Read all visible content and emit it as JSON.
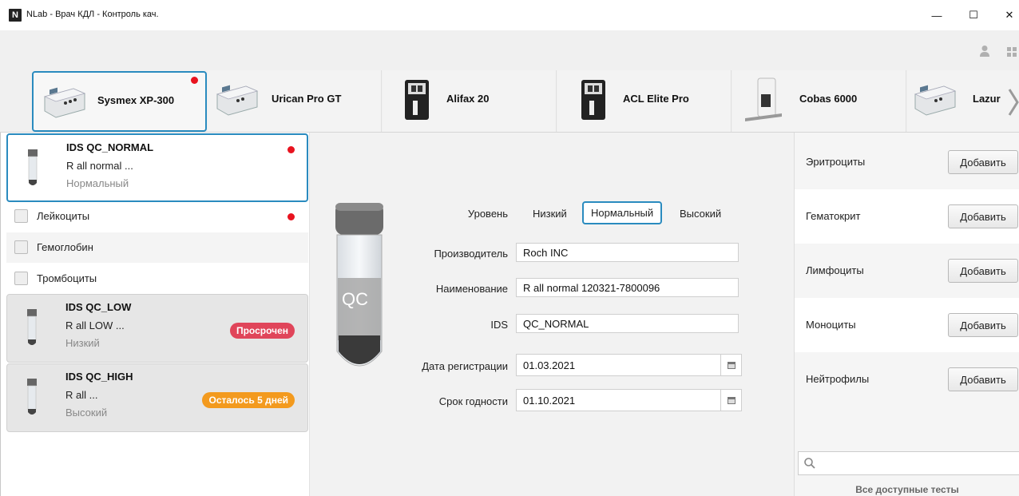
{
  "window": {
    "logo_letter": "N",
    "title": "NLab - Врач КДЛ - Контроль кач.",
    "minimize": "—",
    "maximize": "☐",
    "close": "✕"
  },
  "toolbar": {
    "icons": [
      "user-icon",
      "grid-icon"
    ]
  },
  "devices": [
    {
      "label": "Sysmex XP-300",
      "active": true,
      "alert": true
    },
    {
      "label": "Urican Pro GT",
      "active": false,
      "alert": false
    },
    {
      "label": "Alifax 20",
      "active": false,
      "alert": false
    },
    {
      "label": "ACL Elite Pro",
      "active": false,
      "alert": false
    },
    {
      "label": "Cobas 6000",
      "active": false,
      "alert": false
    },
    {
      "label": "Lazur",
      "active": false,
      "alert": false
    }
  ],
  "qc_list": {
    "selected": {
      "name": "IDS QC_NORMAL",
      "desc": "R all normal ...",
      "level": "Нормальный"
    },
    "params": [
      {
        "label": "Лейкоциты",
        "alert": true
      },
      {
        "label": "Гемоглобин",
        "alert": false
      },
      {
        "label": "Тромбоциты",
        "alert": false
      }
    ],
    "low": {
      "name": "IDS QC_LOW",
      "desc": "R all LOW ...",
      "level": "Низкий",
      "badge": "Просрочен",
      "badge_color": "#e0455a"
    },
    "high": {
      "name": "IDS QC_HIGH",
      "desc": "R all ...",
      "level": "Высокий",
      "badge": "Осталось 5 дней",
      "badge_color": "#f39a1e"
    }
  },
  "form": {
    "tube_label": "QC",
    "level_label": "Уровень",
    "levels": [
      "Низкий",
      "Нормальный",
      "Высокий"
    ],
    "selected_level": "Нормальный",
    "manufacturer_label": "Производитель",
    "manufacturer_value": "Roch INC",
    "name_label": "Наименование",
    "name_value": "R all normal 120321-7800096",
    "ids_label": "IDS",
    "ids_value": "QC_NORMAL",
    "reg_date_label": "Дата регистрации",
    "reg_date_value": "01.03.2021",
    "expiry_label": "Срок годности",
    "expiry_value": "01.10.2021"
  },
  "tests": {
    "add_label": "Добавить",
    "items": [
      "Эритроциты",
      "Гематокрит",
      "Лимфоциты",
      "Моноциты",
      "Нейтрофилы"
    ],
    "search_placeholder": "",
    "all_tests_label": "Все доступные тесты"
  },
  "colors": {
    "accent": "#2a8bbf",
    "alert_dot": "#e8131f"
  }
}
